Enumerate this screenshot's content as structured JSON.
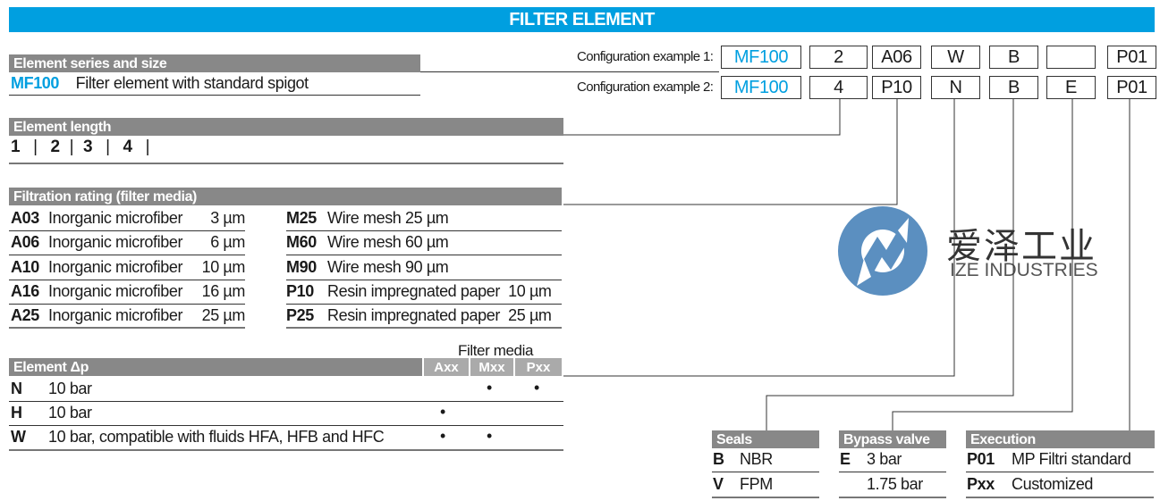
{
  "title": "FILTER ELEMENT",
  "config_examples": {
    "rows": [
      {
        "label": "Configuration example 1:",
        "values": [
          "MF100",
          "2",
          "A06",
          "W",
          "B",
          "",
          "P01"
        ]
      },
      {
        "label": "Configuration example 2:",
        "values": [
          "MF100",
          "4",
          "P10",
          "N",
          "B",
          "E",
          "P01"
        ]
      }
    ]
  },
  "series": {
    "heading": "Element series and size",
    "code": "MF100",
    "description": "Filter element with standard spigot"
  },
  "length": {
    "heading": "Element length",
    "options": [
      "1",
      "2",
      "3",
      "4"
    ]
  },
  "filtration": {
    "heading": "Filtration rating (filter media)",
    "left": [
      {
        "code": "A03",
        "desc": "Inorganic microfiber",
        "rating": "3 µm"
      },
      {
        "code": "A06",
        "desc": "Inorganic microfiber",
        "rating": "6 µm"
      },
      {
        "code": "A10",
        "desc": "Inorganic microfiber",
        "rating": "10 µm"
      },
      {
        "code": "A16",
        "desc": "Inorganic microfiber",
        "rating": "16 µm"
      },
      {
        "code": "A25",
        "desc": "Inorganic microfiber",
        "rating": "25 µm"
      }
    ],
    "right": [
      {
        "code": "M25",
        "desc": "Wire mesh 25 µm"
      },
      {
        "code": "M60",
        "desc": "Wire mesh 60 µm"
      },
      {
        "code": "M90",
        "desc": "Wire mesh 90 µm"
      },
      {
        "code": "P10",
        "desc": "Resin impregnated paper  10 µm"
      },
      {
        "code": "P25",
        "desc": "Resin impregnated paper  25 µm"
      }
    ]
  },
  "delta_p": {
    "heading": "Element Δp",
    "media_label": "Filter media",
    "media_columns": [
      "Axx",
      "Mxx",
      "Pxx"
    ],
    "dot_symbol": "•",
    "rows": [
      {
        "code": "N",
        "desc": "10 bar",
        "axx": false,
        "mxx": true,
        "pxx": true
      },
      {
        "code": "H",
        "desc": "10 bar",
        "axx": true,
        "mxx": false,
        "pxx": false
      },
      {
        "code": "W",
        "desc": "10 bar, compatible with fluids HFA, HFB and HFC",
        "axx": true,
        "mxx": true,
        "pxx": false
      }
    ]
  },
  "seals": {
    "heading": "Seals",
    "rows": [
      {
        "code": "B",
        "desc": "NBR"
      },
      {
        "code": "V",
        "desc": "FPM"
      }
    ]
  },
  "bypass": {
    "heading": "Bypass valve",
    "rows": [
      {
        "code": "E",
        "desc": "3 bar"
      },
      {
        "code": "",
        "desc": "1.75 bar"
      }
    ]
  },
  "execution": {
    "heading": "Execution",
    "rows": [
      {
        "code": "P01",
        "desc": "MP Filtri standard"
      },
      {
        "code": "Pxx",
        "desc": "Customized"
      }
    ]
  },
  "watermark": {
    "cn": "爱泽工业",
    "en": "IZE INDUSTRIES"
  },
  "colors": {
    "accent": "#009fe0",
    "section_header": "#888888",
    "media_header": "#aaaaaa",
    "logo_blue": "#5b8fc0"
  }
}
